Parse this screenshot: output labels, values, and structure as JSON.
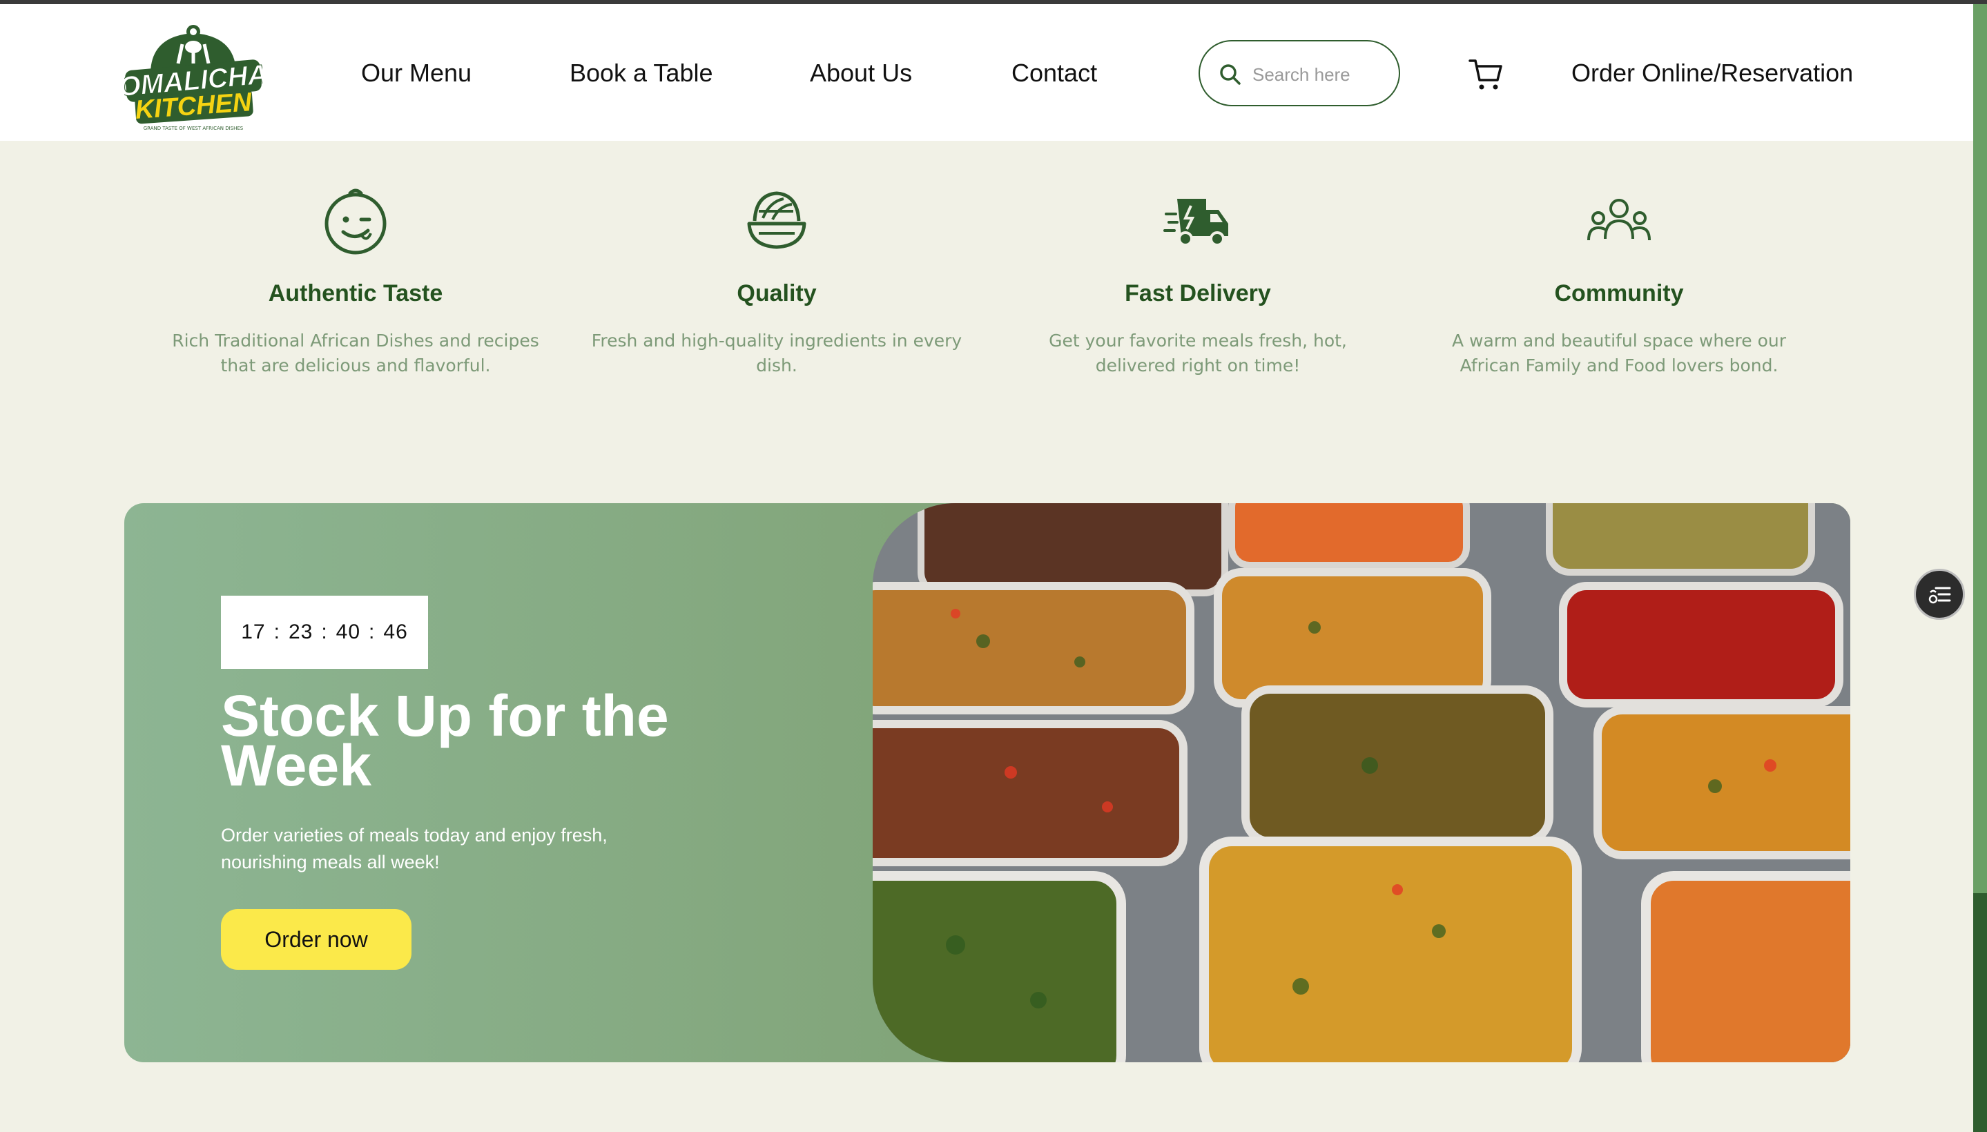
{
  "brand": {
    "logo_line1": "OMALICHA",
    "logo_line2": "KITCHEN",
    "logo_tagline": "GRAND TASTE OF WEST AFRICAN DISHES",
    "primary_color": "#2f5d2e",
    "accent_color": "#fbe94a"
  },
  "nav": {
    "links": [
      "Our Menu",
      "Book a Table",
      "About Us",
      "Contact"
    ],
    "search_placeholder": "Search here",
    "cart_icon": "cart-icon",
    "order_link": "Order Online/Reservation"
  },
  "features": [
    {
      "icon": "smiley-face-icon",
      "title": "Authentic Taste",
      "text": "Rich Traditional African Dishes and recipes that are delicious and flavorful."
    },
    {
      "icon": "food-bowl-icon",
      "title": "Quality",
      "text": "Fresh and high-quality ingredients in every dish."
    },
    {
      "icon": "delivery-truck-icon",
      "title": "Fast Delivery",
      "text": "Get your favorite meals fresh, hot, delivered right on time!"
    },
    {
      "icon": "community-icon",
      "title": "Community",
      "text": "A warm and beautiful space where our African Family and Food lovers bond."
    }
  ],
  "promo": {
    "countdown": {
      "days": "17",
      "hours": "23",
      "minutes": "40",
      "seconds": "46",
      "separator": ":"
    },
    "title": "Stock Up for the Week",
    "subtitle": "Order varieties of meals today and enjoy fresh, nourishing meals all week!",
    "button_label": "Order now",
    "image_icon": "food-containers-photo"
  },
  "floating_button": {
    "icon": "list-menu-icon"
  }
}
